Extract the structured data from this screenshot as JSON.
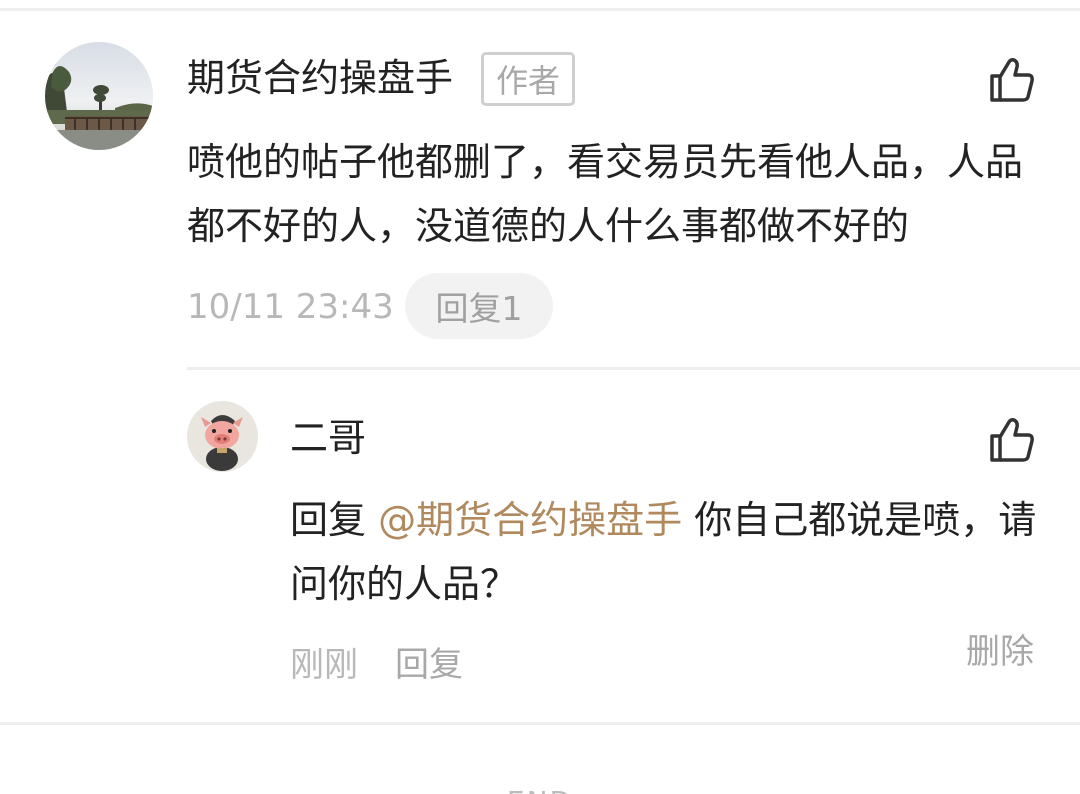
{
  "comment": {
    "username": "期货合约操盘手",
    "badge": "作者",
    "text": "喷他的帖子他都删了，看交易员先看他人品，人品都不好的人，没道德的人什么事都做不好的",
    "timestamp": "10/11 23:43",
    "reply_count_label": "回复1"
  },
  "reply": {
    "username": "二哥",
    "prefix": "回复 ",
    "mention": "@期货合约操盘手",
    "text": " 你自己都说是喷，请问你的人品？",
    "time": "刚刚",
    "reply_label": "回复",
    "delete_label": "删除"
  },
  "footer": {
    "end_label": "END"
  },
  "icons": {
    "like": "thumbs-up-icon"
  },
  "colors": {
    "mention": "#b08a5e",
    "meta_text": "#b8b8b8",
    "primary_text": "#222222"
  }
}
